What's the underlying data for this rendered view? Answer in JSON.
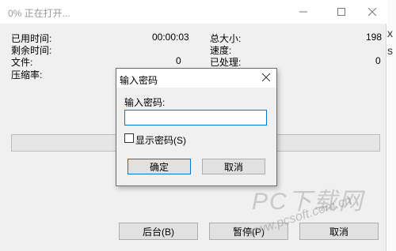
{
  "window": {
    "title": "0% 正在打开..."
  },
  "stats": {
    "elapsed_label": "已用时间:",
    "elapsed_value": "00:00:03",
    "remaining_label": "剩余时间:",
    "files_label": "文件:",
    "files_value": "0",
    "ratio_label": "压缩率:",
    "total_size_label": "总大小:",
    "total_size_value": "198",
    "speed_label": "速度:",
    "processed_label": "已处理:",
    "processed_value": "0"
  },
  "progress": {
    "percent": 0
  },
  "buttons": {
    "background": "后台(B)",
    "pause": "暂停(P)",
    "cancel": "取消"
  },
  "dialog": {
    "title": "输入密码",
    "label": "输入密码:",
    "input_value": "",
    "show_password": "显示密码(S)",
    "ok": "确定",
    "cancel": "取消"
  },
  "watermark": {
    "name": "PC下载网",
    "url": "www.pcsoft.com.cn"
  },
  "icons": [
    "minimize-icon",
    "maximize-icon",
    "close-icon",
    "dialog-close-icon"
  ]
}
